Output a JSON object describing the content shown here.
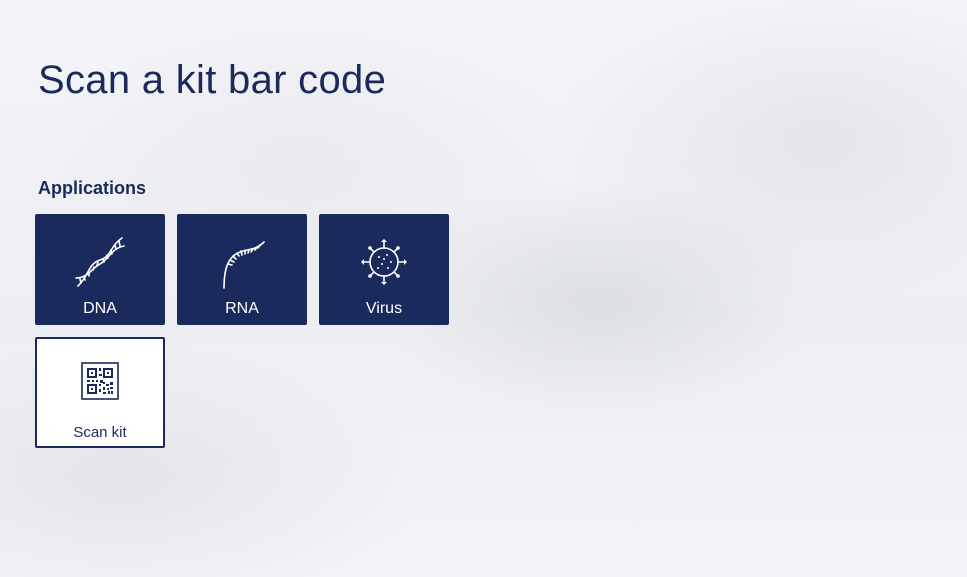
{
  "page": {
    "title": "Scan a kit bar code",
    "section_label": "Applications"
  },
  "tiles": [
    {
      "label": "DNA",
      "icon": "dna-icon"
    },
    {
      "label": "RNA",
      "icon": "rna-icon"
    },
    {
      "label": "Virus",
      "icon": "virus-icon"
    },
    {
      "label": "Scan kit",
      "icon": "qr-code-icon"
    }
  ],
  "colors": {
    "primary": "#1b2a5c",
    "tile_text": "#ffffff",
    "background": "#eef0f4"
  }
}
